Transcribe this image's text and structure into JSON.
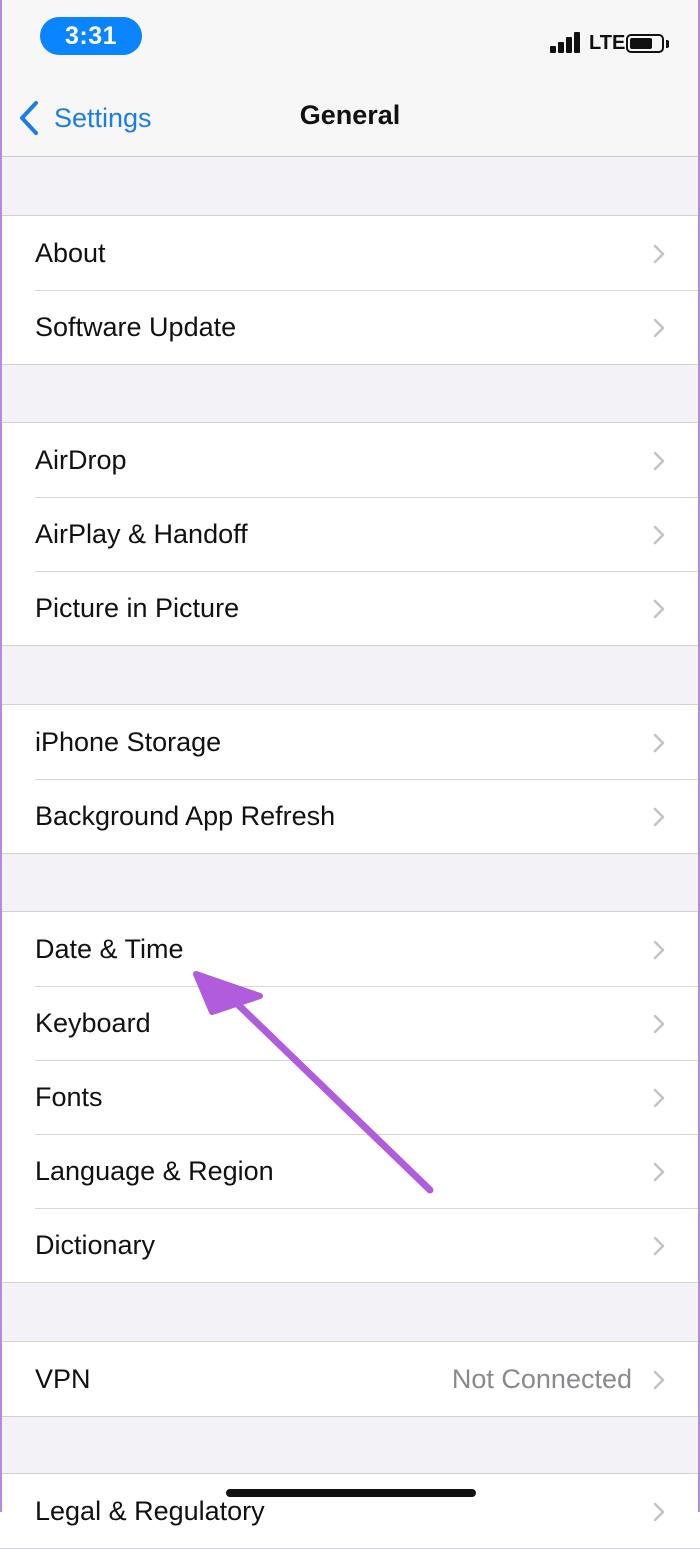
{
  "status_bar": {
    "time": "3:31",
    "network": "LTE",
    "icons": [
      "signal-bars-icon",
      "battery-icon"
    ]
  },
  "nav": {
    "back_label": "Settings",
    "title": "General",
    "back_icon": "chevron-left-icon"
  },
  "groups": [
    {
      "rows": [
        {
          "label": "About"
        },
        {
          "label": "Software Update"
        }
      ]
    },
    {
      "rows": [
        {
          "label": "AirDrop"
        },
        {
          "label": "AirPlay & Handoff"
        },
        {
          "label": "Picture in Picture"
        }
      ]
    },
    {
      "rows": [
        {
          "label": "iPhone Storage"
        },
        {
          "label": "Background App Refresh"
        }
      ]
    },
    {
      "rows": [
        {
          "label": "Date & Time"
        },
        {
          "label": "Keyboard"
        },
        {
          "label": "Fonts"
        },
        {
          "label": "Language & Region"
        },
        {
          "label": "Dictionary"
        }
      ]
    },
    {
      "rows": [
        {
          "label": "VPN",
          "value": "Not Connected"
        }
      ]
    },
    {
      "rows": [
        {
          "label": "Legal & Regulatory"
        }
      ]
    }
  ],
  "colors": {
    "accent": "#1a7dea",
    "annotation_arrow": "#b05cdc",
    "background": "#f2f2f7"
  }
}
